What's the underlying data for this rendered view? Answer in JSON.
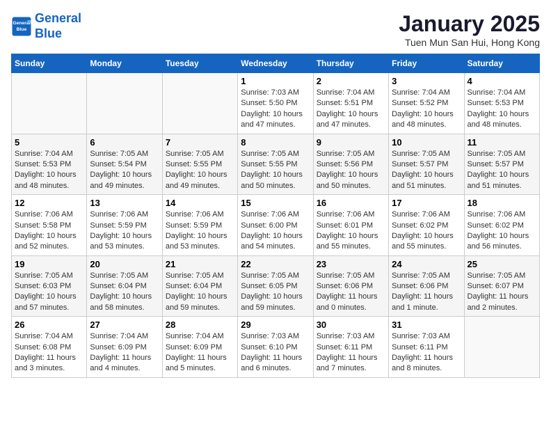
{
  "logo": {
    "line1": "General",
    "line2": "Blue"
  },
  "title": "January 2025",
  "subtitle": "Tuen Mun San Hui, Hong Kong",
  "headers": [
    "Sunday",
    "Monday",
    "Tuesday",
    "Wednesday",
    "Thursday",
    "Friday",
    "Saturday"
  ],
  "weeks": [
    [
      {
        "day": "",
        "sunrise": "",
        "sunset": "",
        "daylight": ""
      },
      {
        "day": "",
        "sunrise": "",
        "sunset": "",
        "daylight": ""
      },
      {
        "day": "",
        "sunrise": "",
        "sunset": "",
        "daylight": ""
      },
      {
        "day": "1",
        "sunrise": "Sunrise: 7:03 AM",
        "sunset": "Sunset: 5:50 PM",
        "daylight": "Daylight: 10 hours and 47 minutes."
      },
      {
        "day": "2",
        "sunrise": "Sunrise: 7:04 AM",
        "sunset": "Sunset: 5:51 PM",
        "daylight": "Daylight: 10 hours and 47 minutes."
      },
      {
        "day": "3",
        "sunrise": "Sunrise: 7:04 AM",
        "sunset": "Sunset: 5:52 PM",
        "daylight": "Daylight: 10 hours and 48 minutes."
      },
      {
        "day": "4",
        "sunrise": "Sunrise: 7:04 AM",
        "sunset": "Sunset: 5:53 PM",
        "daylight": "Daylight: 10 hours and 48 minutes."
      }
    ],
    [
      {
        "day": "5",
        "sunrise": "Sunrise: 7:04 AM",
        "sunset": "Sunset: 5:53 PM",
        "daylight": "Daylight: 10 hours and 48 minutes."
      },
      {
        "day": "6",
        "sunrise": "Sunrise: 7:05 AM",
        "sunset": "Sunset: 5:54 PM",
        "daylight": "Daylight: 10 hours and 49 minutes."
      },
      {
        "day": "7",
        "sunrise": "Sunrise: 7:05 AM",
        "sunset": "Sunset: 5:55 PM",
        "daylight": "Daylight: 10 hours and 49 minutes."
      },
      {
        "day": "8",
        "sunrise": "Sunrise: 7:05 AM",
        "sunset": "Sunset: 5:55 PM",
        "daylight": "Daylight: 10 hours and 50 minutes."
      },
      {
        "day": "9",
        "sunrise": "Sunrise: 7:05 AM",
        "sunset": "Sunset: 5:56 PM",
        "daylight": "Daylight: 10 hours and 50 minutes."
      },
      {
        "day": "10",
        "sunrise": "Sunrise: 7:05 AM",
        "sunset": "Sunset: 5:57 PM",
        "daylight": "Daylight: 10 hours and 51 minutes."
      },
      {
        "day": "11",
        "sunrise": "Sunrise: 7:05 AM",
        "sunset": "Sunset: 5:57 PM",
        "daylight": "Daylight: 10 hours and 51 minutes."
      }
    ],
    [
      {
        "day": "12",
        "sunrise": "Sunrise: 7:06 AM",
        "sunset": "Sunset: 5:58 PM",
        "daylight": "Daylight: 10 hours and 52 minutes."
      },
      {
        "day": "13",
        "sunrise": "Sunrise: 7:06 AM",
        "sunset": "Sunset: 5:59 PM",
        "daylight": "Daylight: 10 hours and 53 minutes."
      },
      {
        "day": "14",
        "sunrise": "Sunrise: 7:06 AM",
        "sunset": "Sunset: 5:59 PM",
        "daylight": "Daylight: 10 hours and 53 minutes."
      },
      {
        "day": "15",
        "sunrise": "Sunrise: 7:06 AM",
        "sunset": "Sunset: 6:00 PM",
        "daylight": "Daylight: 10 hours and 54 minutes."
      },
      {
        "day": "16",
        "sunrise": "Sunrise: 7:06 AM",
        "sunset": "Sunset: 6:01 PM",
        "daylight": "Daylight: 10 hours and 55 minutes."
      },
      {
        "day": "17",
        "sunrise": "Sunrise: 7:06 AM",
        "sunset": "Sunset: 6:02 PM",
        "daylight": "Daylight: 10 hours and 55 minutes."
      },
      {
        "day": "18",
        "sunrise": "Sunrise: 7:06 AM",
        "sunset": "Sunset: 6:02 PM",
        "daylight": "Daylight: 10 hours and 56 minutes."
      }
    ],
    [
      {
        "day": "19",
        "sunrise": "Sunrise: 7:05 AM",
        "sunset": "Sunset: 6:03 PM",
        "daylight": "Daylight: 10 hours and 57 minutes."
      },
      {
        "day": "20",
        "sunrise": "Sunrise: 7:05 AM",
        "sunset": "Sunset: 6:04 PM",
        "daylight": "Daylight: 10 hours and 58 minutes."
      },
      {
        "day": "21",
        "sunrise": "Sunrise: 7:05 AM",
        "sunset": "Sunset: 6:04 PM",
        "daylight": "Daylight: 10 hours and 59 minutes."
      },
      {
        "day": "22",
        "sunrise": "Sunrise: 7:05 AM",
        "sunset": "Sunset: 6:05 PM",
        "daylight": "Daylight: 10 hours and 59 minutes."
      },
      {
        "day": "23",
        "sunrise": "Sunrise: 7:05 AM",
        "sunset": "Sunset: 6:06 PM",
        "daylight": "Daylight: 11 hours and 0 minutes."
      },
      {
        "day": "24",
        "sunrise": "Sunrise: 7:05 AM",
        "sunset": "Sunset: 6:06 PM",
        "daylight": "Daylight: 11 hours and 1 minute."
      },
      {
        "day": "25",
        "sunrise": "Sunrise: 7:05 AM",
        "sunset": "Sunset: 6:07 PM",
        "daylight": "Daylight: 11 hours and 2 minutes."
      }
    ],
    [
      {
        "day": "26",
        "sunrise": "Sunrise: 7:04 AM",
        "sunset": "Sunset: 6:08 PM",
        "daylight": "Daylight: 11 hours and 3 minutes."
      },
      {
        "day": "27",
        "sunrise": "Sunrise: 7:04 AM",
        "sunset": "Sunset: 6:09 PM",
        "daylight": "Daylight: 11 hours and 4 minutes."
      },
      {
        "day": "28",
        "sunrise": "Sunrise: 7:04 AM",
        "sunset": "Sunset: 6:09 PM",
        "daylight": "Daylight: 11 hours and 5 minutes."
      },
      {
        "day": "29",
        "sunrise": "Sunrise: 7:03 AM",
        "sunset": "Sunset: 6:10 PM",
        "daylight": "Daylight: 11 hours and 6 minutes."
      },
      {
        "day": "30",
        "sunrise": "Sunrise: 7:03 AM",
        "sunset": "Sunset: 6:11 PM",
        "daylight": "Daylight: 11 hours and 7 minutes."
      },
      {
        "day": "31",
        "sunrise": "Sunrise: 7:03 AM",
        "sunset": "Sunset: 6:11 PM",
        "daylight": "Daylight: 11 hours and 8 minutes."
      },
      {
        "day": "",
        "sunrise": "",
        "sunset": "",
        "daylight": ""
      }
    ]
  ]
}
